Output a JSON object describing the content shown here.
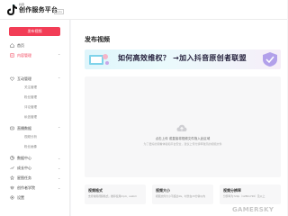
{
  "header": {
    "brand_small": "抖音",
    "brand": "创作服务平台",
    "tag": "Beta"
  },
  "sidebar": {
    "upload_label": "发布视频",
    "items": [
      {
        "label": "首页",
        "icon": "home-icon"
      },
      {
        "label": "内容管理",
        "icon": "content-icon",
        "active": true
      },
      {
        "label": "互动管理",
        "icon": "interaction-icon"
      },
      {
        "label": "直播数据",
        "icon": "live-data-icon"
      },
      {
        "label": "数据中心",
        "icon": "data-center-icon"
      },
      {
        "label": "成长中心",
        "icon": "growth-icon"
      },
      {
        "label": "星图任务",
        "icon": "star-task-icon"
      },
      {
        "label": "创作者学院",
        "icon": "academy-icon"
      },
      {
        "label": "设置",
        "icon": "settings-icon"
      }
    ],
    "sub_items": [
      "关注管理",
      "粉丝管理",
      "评论管理",
      "私信管理",
      "视频分析",
      "粉丝画像"
    ]
  },
  "main": {
    "title": "发布视频",
    "banner_text": "如何高效维权？ →加入抖音原创者联盟",
    "upload_hint": "点击上传 或直接将视频文件拖入此区域",
    "upload_subhint": "为了更好的观看体验和平台安全，建议上传分辨率较高的视频文件",
    "cards": [
      {
        "title": "视频格式",
        "desc": "支持常用视频格式，推荐使用mp4、webm"
      },
      {
        "title": "视频大小",
        "desc": "视频文件大小不超过4G，时长在15分钟以内"
      },
      {
        "title": "视频分辨率",
        "desc": "分辨率为720p（1280x720）及以上"
      }
    ]
  },
  "watermark": "GAMERSKY",
  "colors": {
    "accent": "#f23d56",
    "sidebar_bg": "#ffffff",
    "page_bg": "#f4f4f6"
  }
}
